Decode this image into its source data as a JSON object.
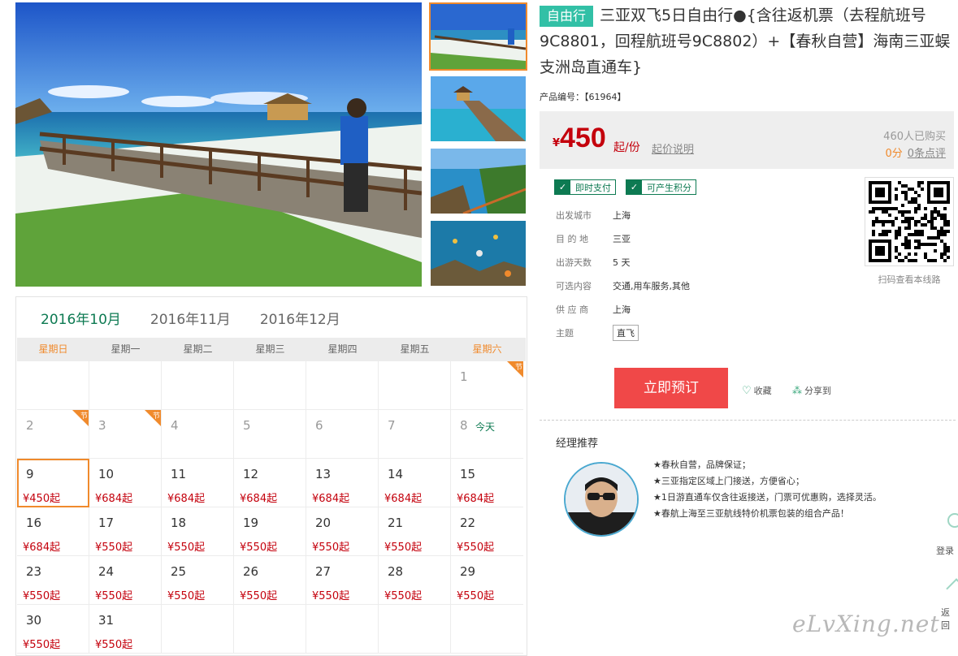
{
  "gallery": {
    "main_alt": "三亚蜈支洲岛栈桥",
    "thumbs": [
      "栈桥",
      "海上亭台",
      "海岸步道",
      "海底珊瑚"
    ]
  },
  "calendar": {
    "months": [
      "2016年10月",
      "2016年11月",
      "2016年12月"
    ],
    "weekdays": [
      "星期日",
      "星期一",
      "星期二",
      "星期三",
      "星期四",
      "星期五",
      "星期六"
    ],
    "holiday_mark": "节",
    "today_label": "今天",
    "days": [
      {
        "d": "",
        "p": ""
      },
      {
        "d": "",
        "p": ""
      },
      {
        "d": "",
        "p": ""
      },
      {
        "d": "",
        "p": ""
      },
      {
        "d": "",
        "p": ""
      },
      {
        "d": "",
        "p": ""
      },
      {
        "d": "1",
        "p": "",
        "past": true,
        "holiday": true
      },
      {
        "d": "2",
        "p": "",
        "past": true,
        "holiday": true
      },
      {
        "d": "3",
        "p": "",
        "past": true,
        "holiday": true
      },
      {
        "d": "4",
        "p": "",
        "past": true
      },
      {
        "d": "5",
        "p": "",
        "past": true
      },
      {
        "d": "6",
        "p": "",
        "past": true
      },
      {
        "d": "7",
        "p": "",
        "past": true
      },
      {
        "d": "8",
        "p": "",
        "past": true,
        "today": true
      },
      {
        "d": "9",
        "p": "¥450起",
        "selected": true
      },
      {
        "d": "10",
        "p": "¥684起"
      },
      {
        "d": "11",
        "p": "¥684起"
      },
      {
        "d": "12",
        "p": "¥684起"
      },
      {
        "d": "13",
        "p": "¥684起"
      },
      {
        "d": "14",
        "p": "¥684起"
      },
      {
        "d": "15",
        "p": "¥684起"
      },
      {
        "d": "16",
        "p": "¥684起"
      },
      {
        "d": "17",
        "p": "¥550起"
      },
      {
        "d": "18",
        "p": "¥550起"
      },
      {
        "d": "19",
        "p": "¥550起"
      },
      {
        "d": "20",
        "p": "¥550起"
      },
      {
        "d": "21",
        "p": "¥550起"
      },
      {
        "d": "22",
        "p": "¥550起"
      },
      {
        "d": "23",
        "p": "¥550起"
      },
      {
        "d": "24",
        "p": "¥550起"
      },
      {
        "d": "25",
        "p": "¥550起"
      },
      {
        "d": "26",
        "p": "¥550起"
      },
      {
        "d": "27",
        "p": "¥550起"
      },
      {
        "d": "28",
        "p": "¥550起"
      },
      {
        "d": "29",
        "p": "¥550起"
      },
      {
        "d": "30",
        "p": "¥550起"
      },
      {
        "d": "31",
        "p": "¥550起"
      },
      {
        "d": "",
        "p": ""
      },
      {
        "d": "",
        "p": ""
      },
      {
        "d": "",
        "p": ""
      },
      {
        "d": "",
        "p": ""
      },
      {
        "d": "",
        "p": ""
      }
    ]
  },
  "product": {
    "tag": "自由行",
    "title": "三亚双飞5日自由行●{含往返机票（去程航班号9C8801，回程航班号9C8802）+【春秋自营】海南三亚蜈支洲岛直通车}",
    "code": "产品编号：【61964】",
    "price_yen": "¥",
    "price": "450",
    "price_unit": "起/份",
    "price_explain": "起价说明",
    "sold": "460人已购买",
    "score": "0分",
    "reviews": "0条点评",
    "badges": [
      "即时支付",
      "可产生积分"
    ],
    "attrs": [
      {
        "k": "出发城市",
        "v": "上海"
      },
      {
        "k": "目 的 地",
        "v": "三亚"
      },
      {
        "k": "出游天数",
        "v": "5 天"
      },
      {
        "k": "可选内容",
        "v": "交通,用车服务,其他"
      },
      {
        "k": "供 应 商",
        "v": "上海"
      },
      {
        "k": "主题",
        "v": "直飞"
      }
    ],
    "qr_caption": "扫码查看本线路",
    "book_label": "立即预订",
    "fav_label": "收藏",
    "share_label": "分享到"
  },
  "manager": {
    "title": "经理推荐",
    "points": [
      "★春秋自营，品牌保证；",
      "★三亚指定区域上门接送，方便省心；",
      "★1日游直通车仅含往返接送，门票可优惠购，选择灵活。",
      "★春航上海至三亚航线特价机票包装的组合产品！"
    ]
  },
  "side": {
    "login": "登录",
    "back": "返回"
  },
  "watermark": "eLvXing.net",
  "colors": {
    "green": "#0d7a52",
    "orange": "#f08a2c",
    "red": "#c4000c",
    "teal": "#32c0a6",
    "button": "#f04848"
  }
}
